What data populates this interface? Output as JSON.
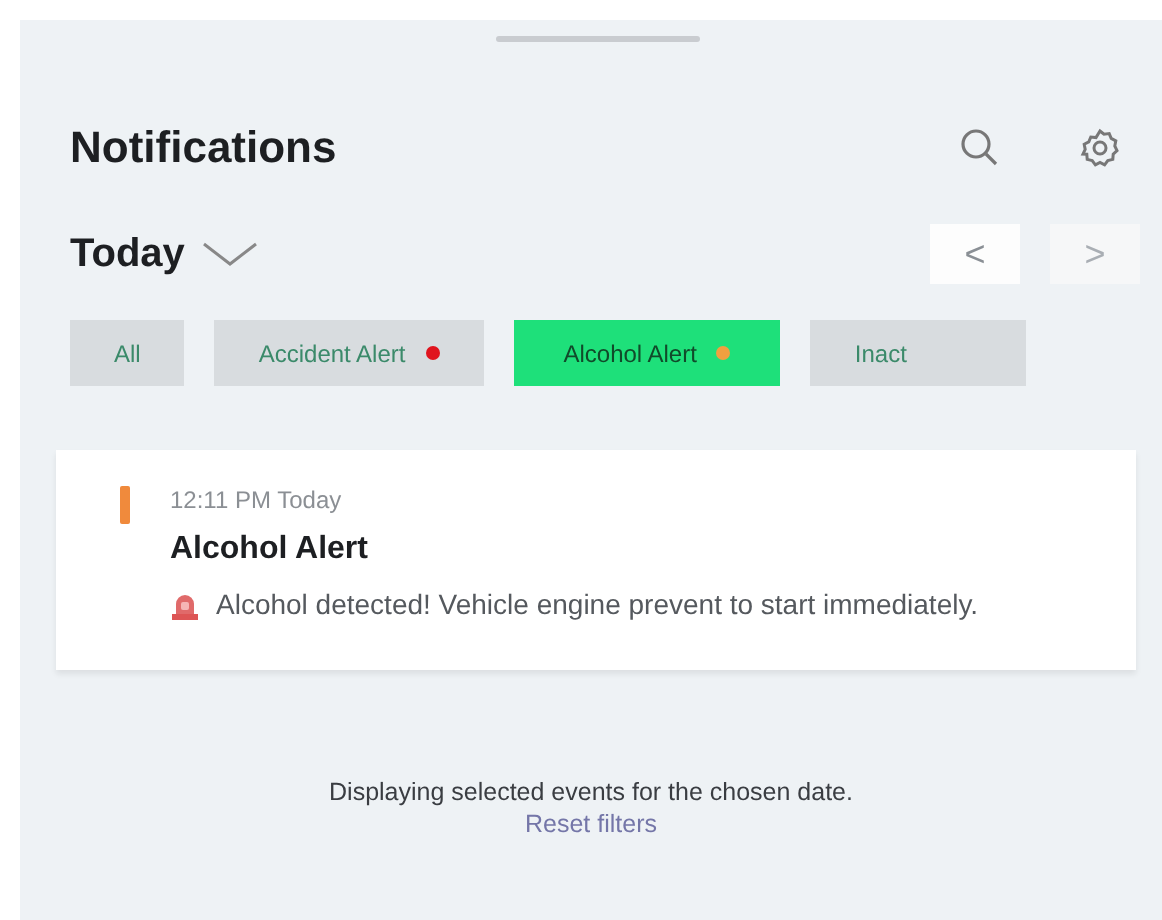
{
  "header": {
    "title": "Notifications"
  },
  "date_picker": {
    "label": "Today",
    "nav": [
      {
        "symbol": "<",
        "disabled": false
      },
      {
        "symbol": ">",
        "disabled": true
      }
    ]
  },
  "filters": [
    {
      "label": "All",
      "selected": false
    },
    {
      "label": "Accident Alert",
      "selected": false,
      "color": "#e0141e"
    },
    {
      "label": "Alcohol Alert",
      "selected": true,
      "color": "#f0a040"
    },
    {
      "label": "Inact",
      "selected": false
    }
  ],
  "notifications": [
    {
      "time": "12:11 PM Today",
      "title": "Alcohol Alert",
      "message": "Alcohol detected! Vehicle engine prevent to start immediately.",
      "color": "#f08a3c"
    }
  ],
  "footer": {
    "text": "Displaying selected events for the chosen date.",
    "link": "Reset filters"
  }
}
